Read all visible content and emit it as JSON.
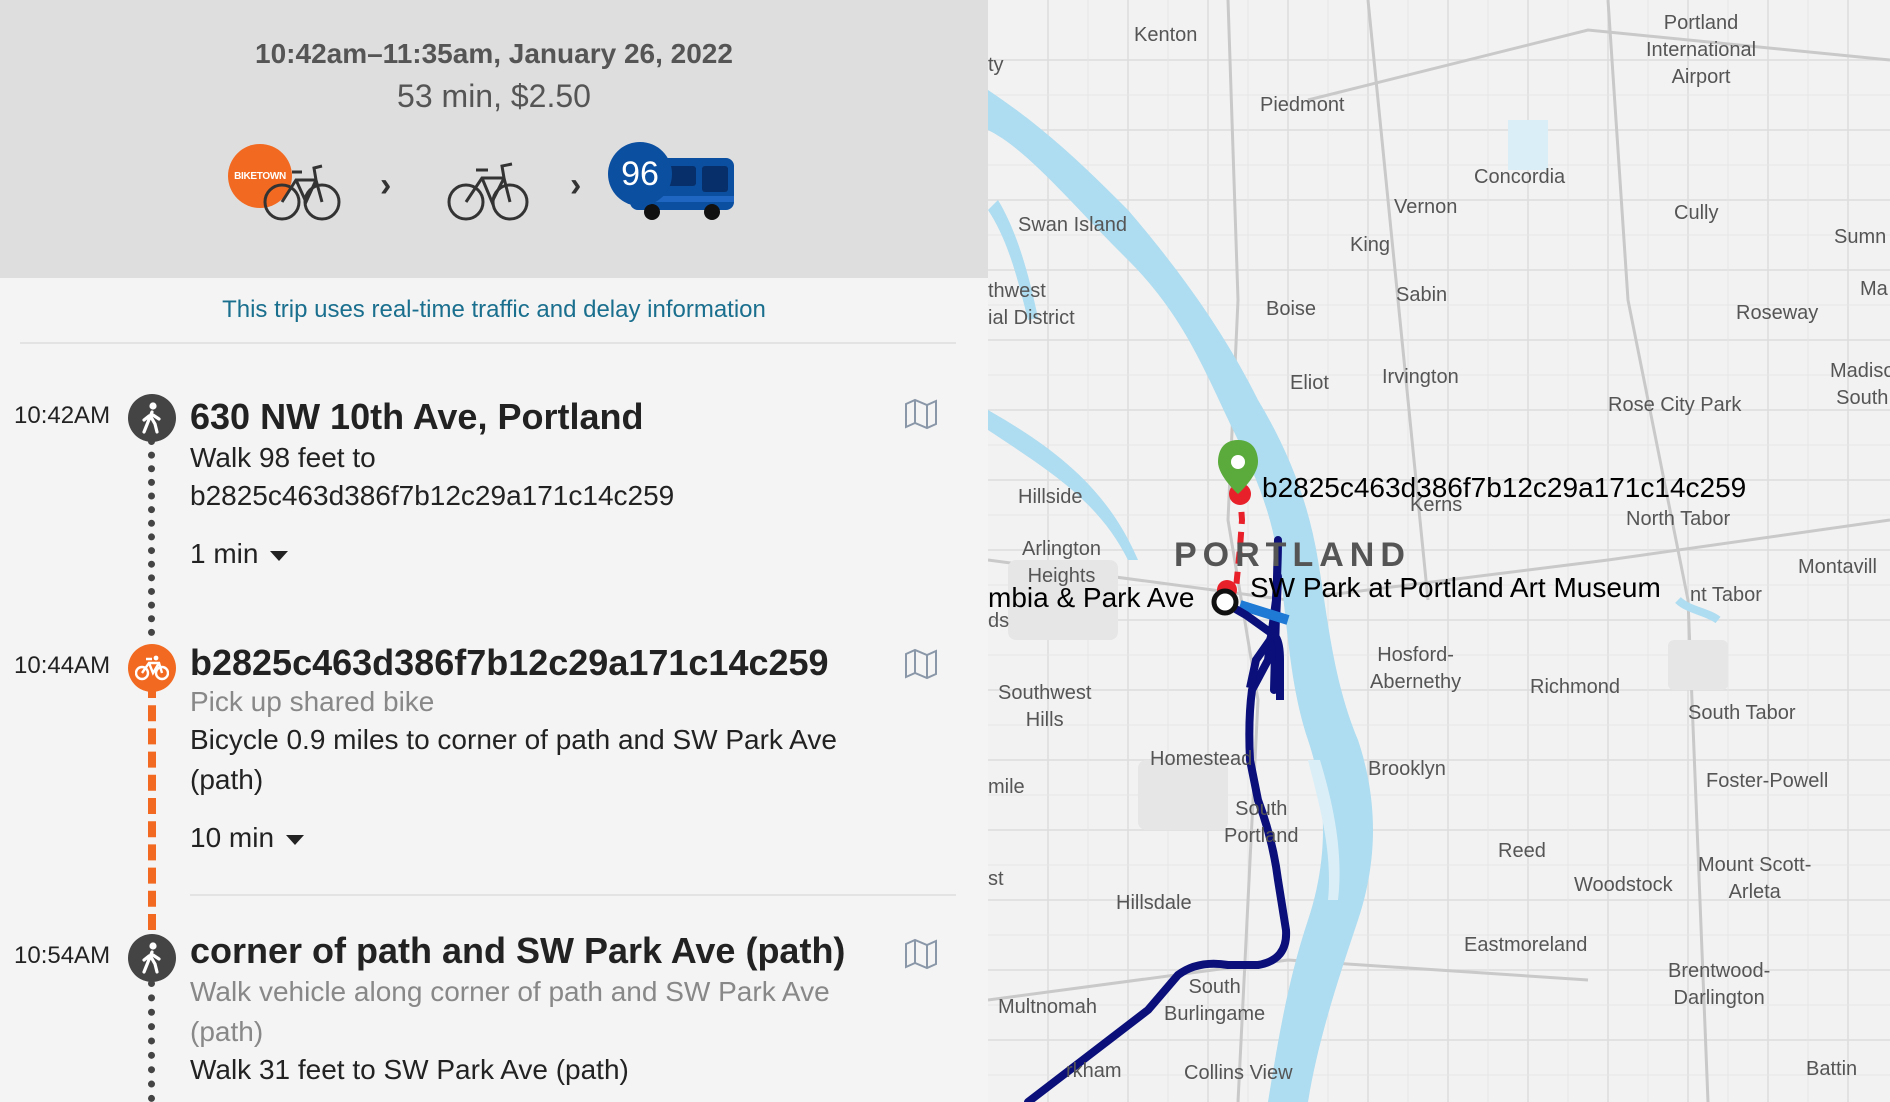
{
  "summary": {
    "times": "10:42am–11:35am, January 26, 2022",
    "duration_fare": "53 min, $2.50",
    "modes": [
      {
        "icon": "biketown-bike-icon",
        "badge": "BIKETOWN"
      },
      {
        "icon": "bicycle-icon"
      },
      {
        "icon": "bus-icon",
        "route": "96"
      }
    ]
  },
  "realtime_notice": "This trip uses real-time traffic and delay information",
  "steps": [
    {
      "time": "10:42AM",
      "mode": "walk-icon",
      "title": "630 NW 10th Ave, Portland",
      "lines": [
        "Walk 98 feet to",
        "b2825c463d386f7b12c29a171c14c259"
      ],
      "duration": "1 min"
    },
    {
      "time": "10:44AM",
      "mode": "bike-icon",
      "title": "b2825c463d386f7b12c29a171c14c259",
      "subtitle": "Pick up shared bike",
      "lines": [
        "Bicycle 0.9 miles to corner of path and SW Park Ave",
        "(path)"
      ],
      "duration": "10 min"
    },
    {
      "time": "10:54AM",
      "mode": "walk-icon",
      "title": "corner of path and SW Park Ave (path)",
      "subtitle_lines": [
        "Walk vehicle along corner of path and SW Park Ave",
        "(path)"
      ],
      "lines": [
        "Walk 31 feet to SW Park Ave (path)"
      ]
    }
  ],
  "map": {
    "city": "PORTLAND",
    "labels": {
      "station": "b2825c463d386f7b12c29a171c14c259",
      "stop": "SW Park at Portland Art Museum",
      "columbia": "mbia & Park Ave"
    },
    "places": {
      "kenton": "Kenton",
      "airport": "Portland\nInternational\nAirport",
      "piedmont": "Piedmont",
      "concordia": "Concordia",
      "swan_island": "Swan Island",
      "vernon": "Vernon",
      "cully": "Cully",
      "sumn": "Sumn",
      "king": "King",
      "ty": "ty",
      "northwest": "thwest\nial District",
      "boise": "Boise",
      "sabin": "Sabin",
      "roseway": "Roseway",
      "ma": "Ma",
      "eliot": "Eliot",
      "irvington": "Irvington",
      "madison": "Madiso\nSouth",
      "rose_city": "Rose City Park",
      "hillside": "Hillside",
      "kerns": "Kerns",
      "north_tabor": "North Tabor",
      "arlington": "Arlington\nHeights",
      "montavilla": "Montavill",
      "mt_tabor": "nt Tabor",
      "ds": "ds",
      "hosford": "Hosford-\nAbernethy",
      "richmond": "Richmond",
      "southwest_hills": "Southwest\nHills",
      "south_tabor": "South Tabor",
      "homestead": "Homestead",
      "brooklyn": "Brooklyn",
      "mile": "mile",
      "south_portland": "South\nPortland",
      "foster": "Foster-Powell",
      "reed": "Reed",
      "st": "st",
      "woodstock": "Woodstock",
      "mount_scott": "Mount Scott-\nArleta",
      "hillsdale": "Hillsdale",
      "eastmoreland": "Eastmoreland",
      "multnomah": "Multnomah",
      "south_burlingame": "South\nBurlingame",
      "brentwood": "Brentwood-\nDarlington",
      "markham": "rkham",
      "collins": "Collins View",
      "battin": "Battin"
    },
    "colors": {
      "bus_route": "#0a0f7a",
      "bike_route": "#e8202a",
      "walk_route": "#1e7ad4",
      "station_pin": "#5aab3c",
      "water": "#aedcf0"
    }
  }
}
